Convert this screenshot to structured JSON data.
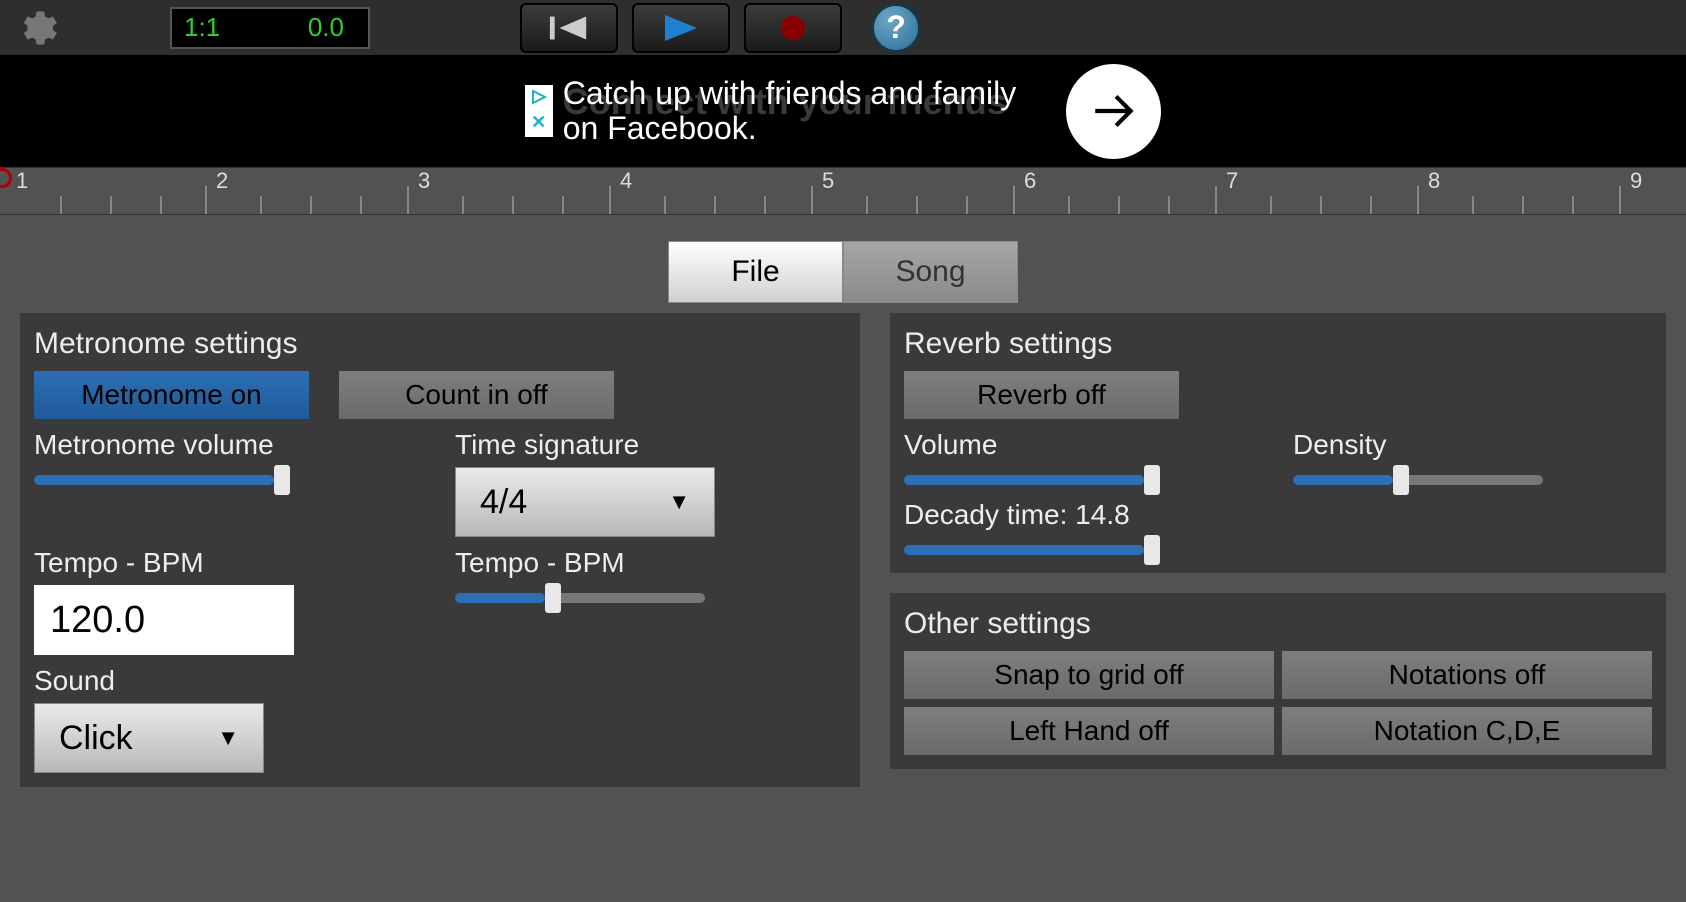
{
  "topbar": {
    "position": "1:1",
    "time": "0.0"
  },
  "ad": {
    "text_line1": "Catch up with friends and family",
    "text_line2": "on Facebook.",
    "ghost_text": "Connect with your friends"
  },
  "ruler": {
    "marks": [
      "1",
      "2",
      "3",
      "4",
      "5",
      "6",
      "7",
      "8",
      "9"
    ]
  },
  "tabs": {
    "file": "File",
    "song": "Song"
  },
  "metronome": {
    "title": "Metronome settings",
    "on": "Metronome on",
    "count": "Count in off",
    "vol_label": "Metronome volume",
    "ts_label": "Time signature",
    "ts_value": "4/4",
    "tempo_label": "Tempo - BPM",
    "tempo_label2": "Tempo - BPM",
    "tempo_value": "120.0",
    "sound_label": "Sound",
    "sound_value": "Click"
  },
  "reverb": {
    "title": "Reverb settings",
    "off": "Reverb off",
    "vol_label": "Volume",
    "den_label": "Density",
    "decay_label": "Decady time: 14.8"
  },
  "other": {
    "title": "Other settings",
    "snap": "Snap to grid off",
    "notations": "Notations off",
    "lefthand": "Left Hand off",
    "notation": "Notation C,D,E"
  }
}
